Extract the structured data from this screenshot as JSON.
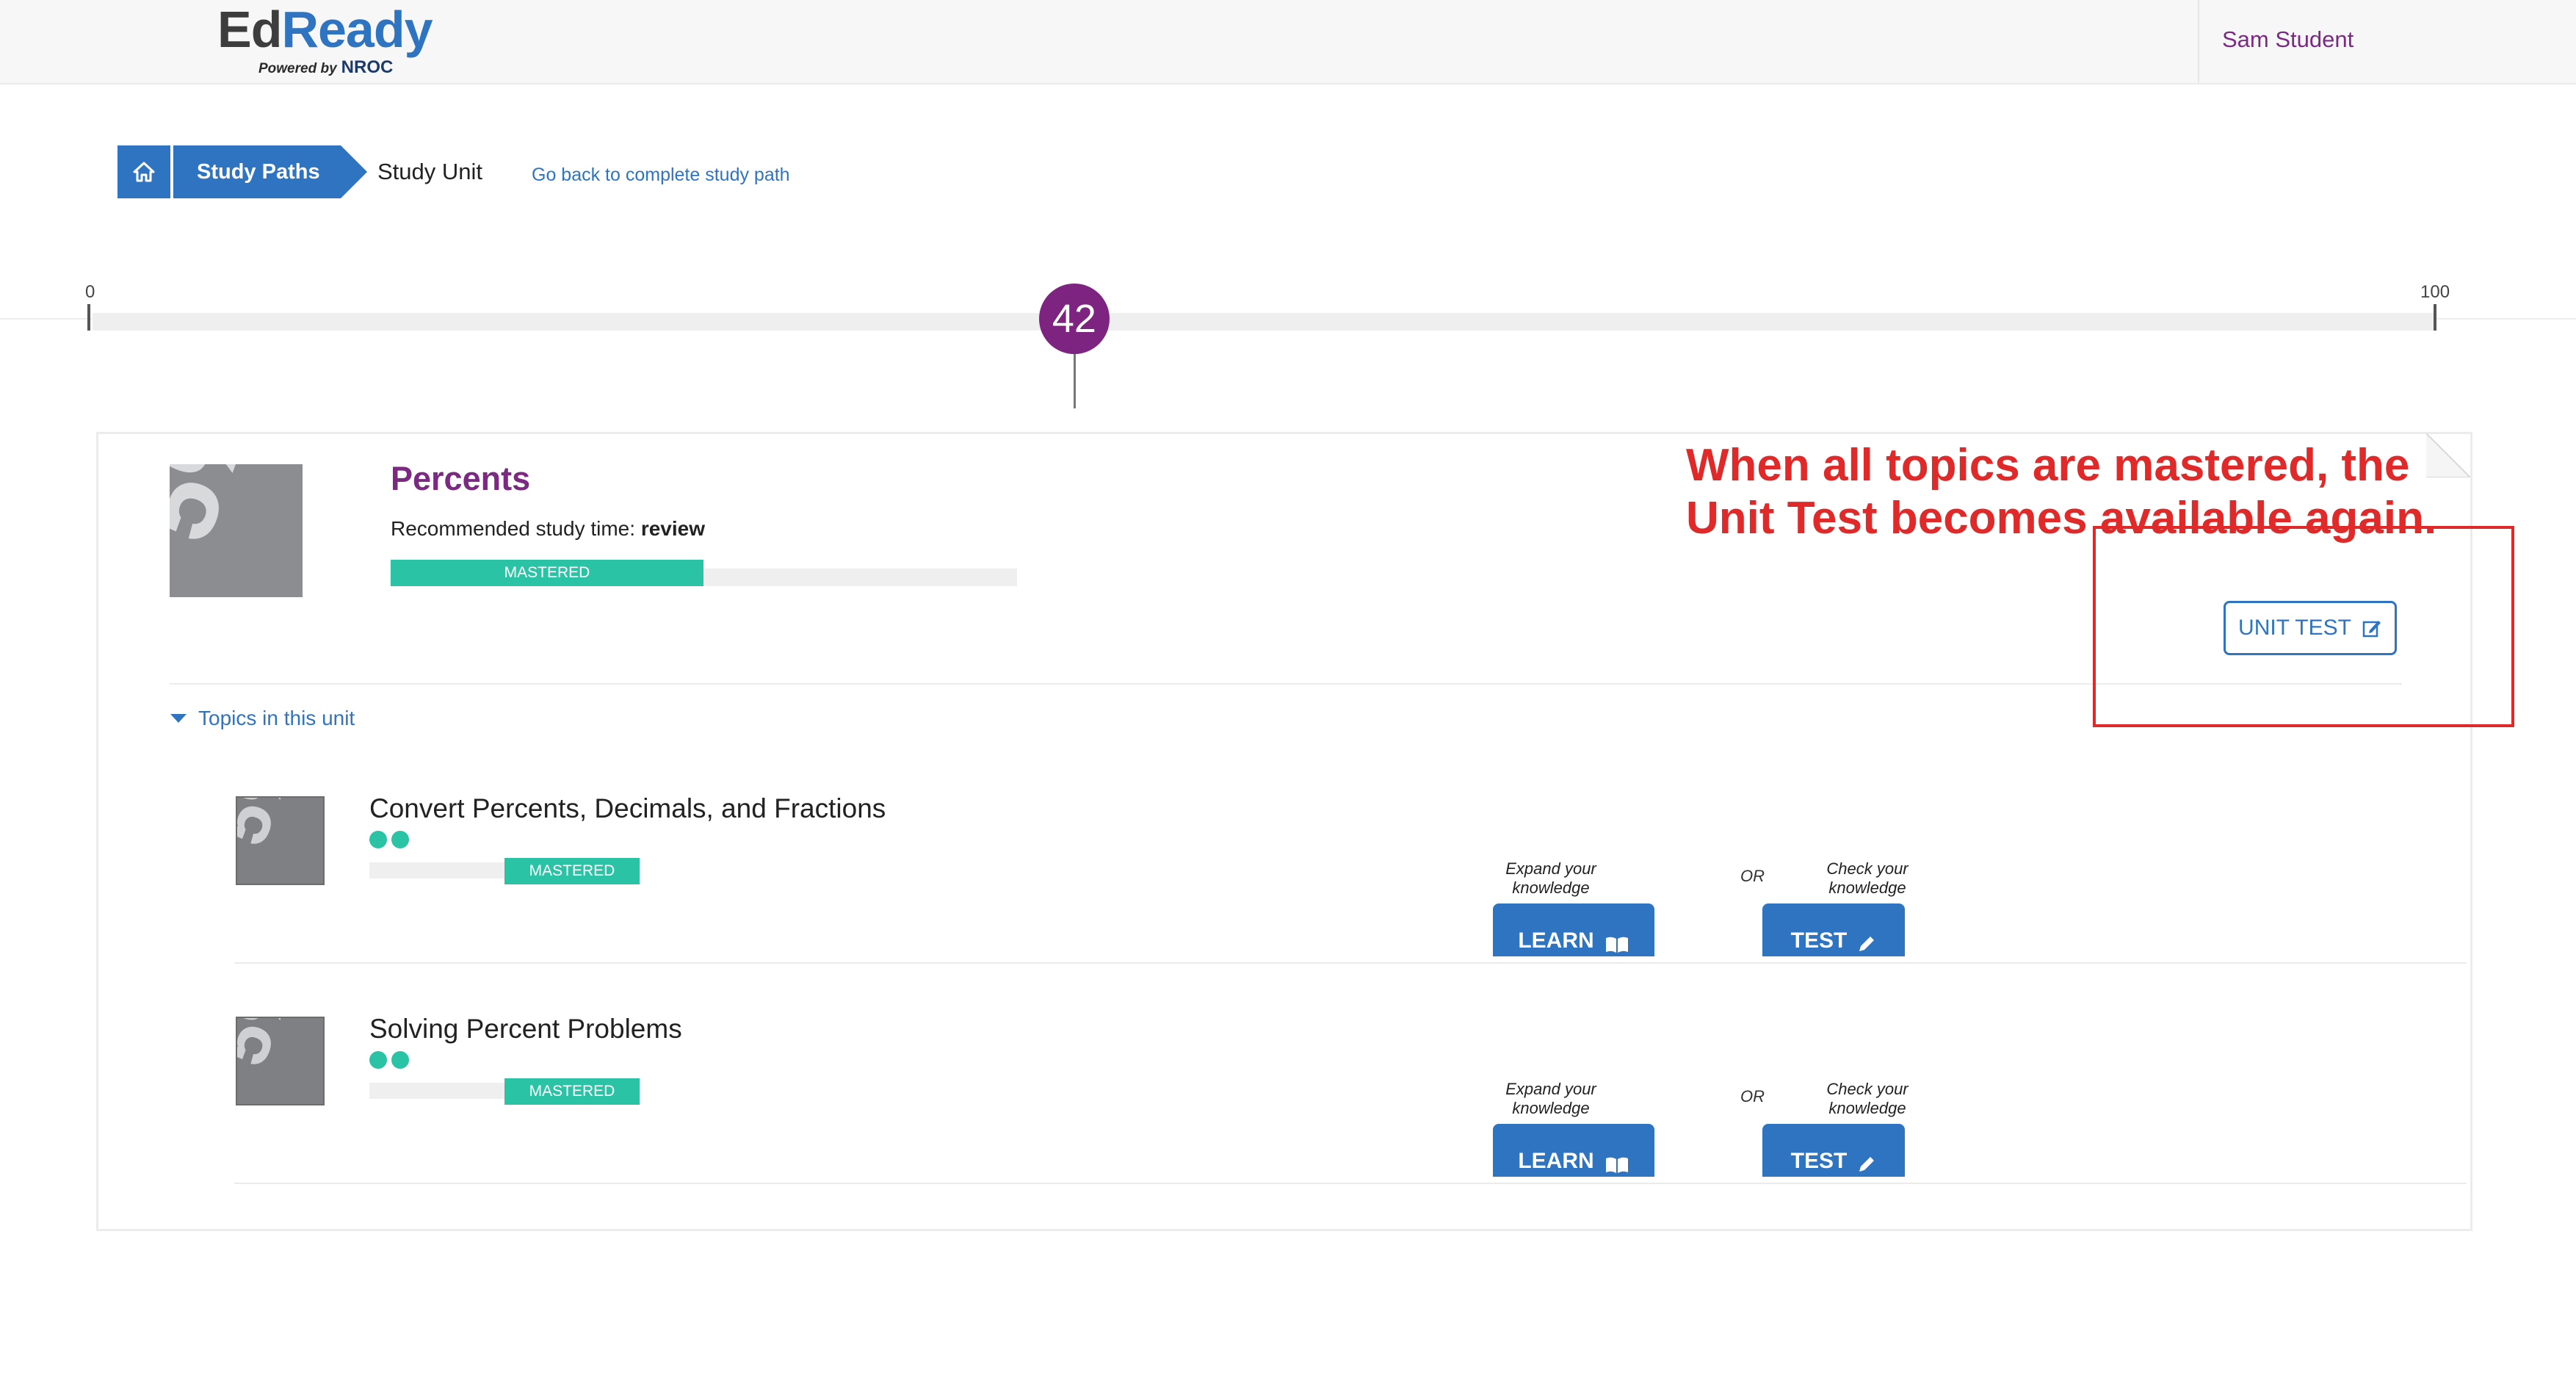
{
  "header": {
    "logo_part1": "Ed",
    "logo_part2": "Ready",
    "logo_tagline": "Powered by",
    "logo_brand": "NROC",
    "user_name": "Sam Student"
  },
  "breadcrumb": {
    "home_icon": "home-icon",
    "study_paths": "Study Paths",
    "current": "Study Unit",
    "back_link": "Go back to complete study path"
  },
  "score": {
    "min": "0",
    "max": "100",
    "value": "42"
  },
  "unit": {
    "title": "Percents",
    "study_time_label": "Recommended study time:",
    "study_time_value": "review",
    "status": "MASTERED",
    "progress_fraction": 0.5,
    "unit_test_label": "UNIT TEST",
    "topics_toggle": "Topics in this unit",
    "thumb_glyph": "5%"
  },
  "topics": [
    {
      "title": "Convert Percents, Decimals, and Fractions",
      "status": "MASTERED",
      "dots": 2,
      "learn_caption": "Expand your knowledge",
      "or_label": "OR",
      "test_caption": "Check your knowledge",
      "learn_label": "LEARN",
      "test_label": "TEST"
    },
    {
      "title": "Solving Percent Problems",
      "status": "MASTERED",
      "dots": 2,
      "learn_caption": "Expand your knowledge",
      "or_label": "OR",
      "test_caption": "Check your knowledge",
      "learn_label": "LEARN",
      "test_label": "TEST"
    }
  ],
  "annotation": {
    "line1": "When all topics are mastered, the",
    "line2": "Unit Test becomes available again."
  },
  "colors": {
    "primary": "#2f74c0",
    "purple": "#7b2a82",
    "mastered": "#2bc3a5",
    "annotation": "#e02a2a"
  }
}
